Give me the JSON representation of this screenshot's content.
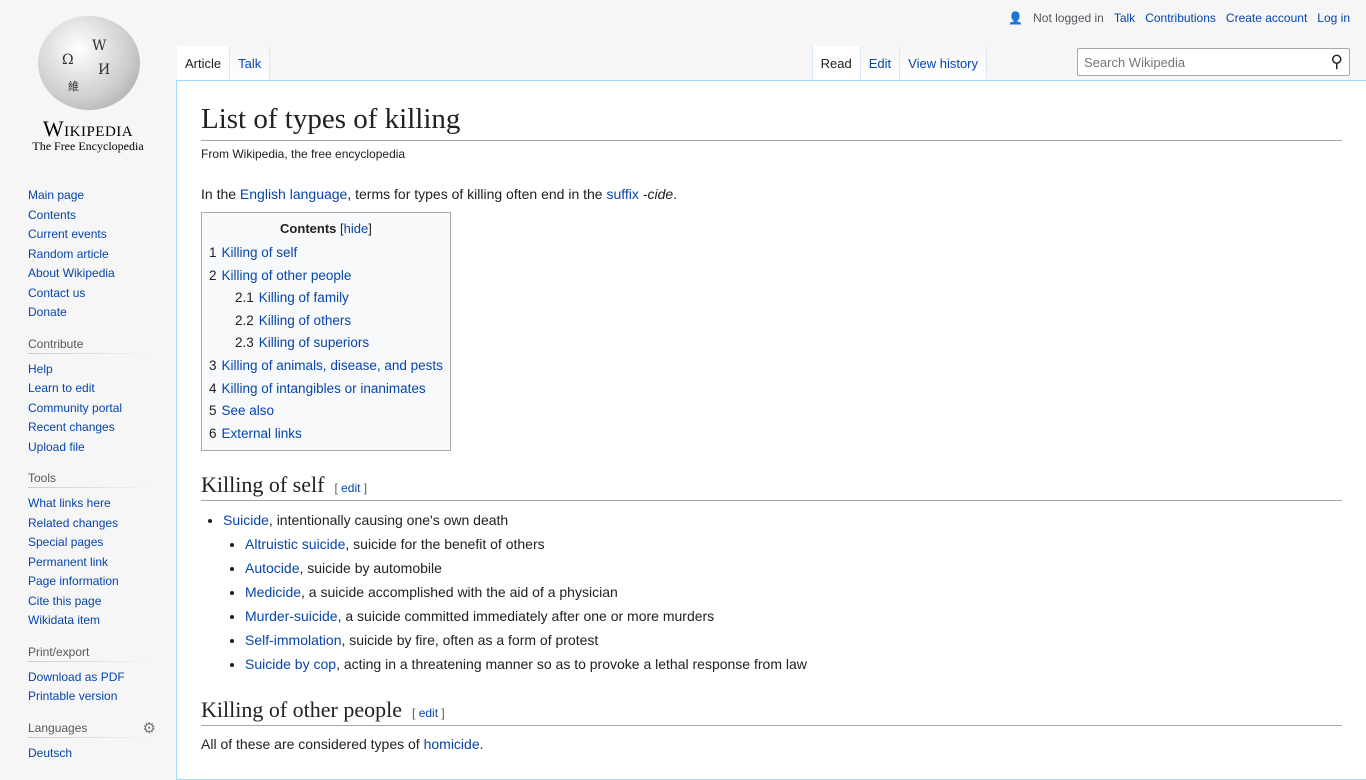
{
  "logo": {
    "wordmark": "Wikipedia",
    "tagline": "The Free Encyclopedia"
  },
  "personal": {
    "status": "Not logged in",
    "links": [
      "Talk",
      "Contributions",
      "Create account",
      "Log in"
    ]
  },
  "tabs": {
    "left": [
      "Article",
      "Talk"
    ],
    "right": [
      "Read",
      "Edit",
      "View history"
    ]
  },
  "search": {
    "placeholder": "Search Wikipedia"
  },
  "sidebar": {
    "nav": [
      "Main page",
      "Contents",
      "Current events",
      "Random article",
      "About Wikipedia",
      "Contact us",
      "Donate"
    ],
    "contribute": {
      "title": "Contribute",
      "items": [
        "Help",
        "Learn to edit",
        "Community portal",
        "Recent changes",
        "Upload file"
      ]
    },
    "tools": {
      "title": "Tools",
      "items": [
        "What links here",
        "Related changes",
        "Special pages",
        "Permanent link",
        "Page information",
        "Cite this page",
        "Wikidata item"
      ]
    },
    "print": {
      "title": "Print/export",
      "items": [
        "Download as PDF",
        "Printable version"
      ]
    },
    "languages": {
      "title": "Languages",
      "items": [
        "Deutsch"
      ]
    }
  },
  "article": {
    "title": "List of types of killing",
    "subtitle": "From Wikipedia, the free encyclopedia",
    "intro": {
      "a": "In the ",
      "link1": "English language",
      "b": ", terms for types of killing often end in the ",
      "link2": "suffix",
      "c": " ",
      "d": "-cide",
      "e": "."
    },
    "toc": {
      "title": "Contents",
      "hide": "hide",
      "items": [
        {
          "n": "1",
          "t": "Killing of self",
          "l": 1
        },
        {
          "n": "2",
          "t": "Killing of other people",
          "l": 1
        },
        {
          "n": "2.1",
          "t": "Killing of family",
          "l": 2
        },
        {
          "n": "2.2",
          "t": "Killing of others",
          "l": 2
        },
        {
          "n": "2.3",
          "t": "Killing of superiors",
          "l": 2
        },
        {
          "n": "3",
          "t": "Killing of animals, disease, and pests",
          "l": 1
        },
        {
          "n": "4",
          "t": "Killing of intangibles or inanimates",
          "l": 1
        },
        {
          "n": "5",
          "t": "See also",
          "l": 1
        },
        {
          "n": "6",
          "t": "External links",
          "l": 1
        }
      ]
    },
    "edit": "edit",
    "s1": {
      "title": "Killing of self",
      "main": {
        "link": "Suicide",
        "text": ", intentionally causing one's own death"
      },
      "items": [
        {
          "link": "Altruistic suicide",
          "text": ", suicide for the benefit of others"
        },
        {
          "link": "Autocide",
          "text": ", suicide by automobile"
        },
        {
          "link": "Medicide",
          "text": ", a suicide accomplished with the aid of a physician"
        },
        {
          "link": "Murder-suicide",
          "text": ", a suicide committed immediately after one or more murders"
        },
        {
          "link": "Self-immolation",
          "text": ", suicide by fire, often as a form of protest"
        },
        {
          "link": "Suicide by cop",
          "text": ", acting in a threatening manner so as to provoke a lethal response from law"
        }
      ]
    },
    "s2": {
      "title": "Killing of other people",
      "text": "All of these are considered types of ",
      "link": "homicide",
      "end": "."
    }
  }
}
